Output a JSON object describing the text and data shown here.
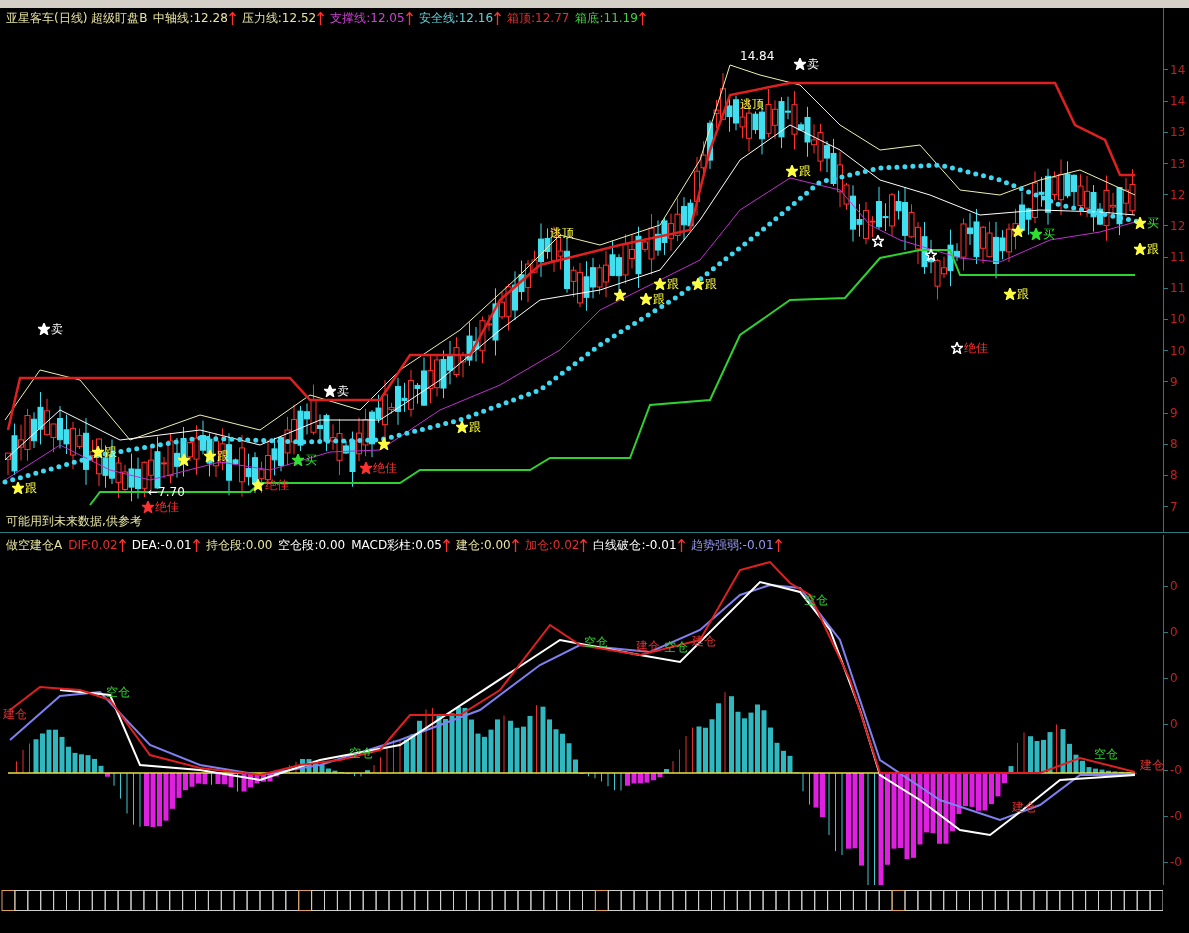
{
  "upper_panel": {
    "legend": [
      {
        "text": "亚星客车(日线) 超级盯盘B",
        "kind": "cream",
        "arrow": false
      },
      {
        "text": "中轴线:12.28",
        "kind": "cream",
        "arrow": true
      },
      {
        "text": "压力线:12.52",
        "kind": "cream",
        "arrow": true
      },
      {
        "text": "支撑线:12.05",
        "kind": "magenta",
        "arrow": true
      },
      {
        "text": "安全线:12.16",
        "kind": "cyan",
        "arrow": true
      },
      {
        "text": "箱顶:12.77",
        "kind": "red",
        "arrow": false
      },
      {
        "text": "箱底:11.19",
        "kind": "green",
        "arrow": true
      }
    ],
    "note": "可能用到未来数据,供参考",
    "markers": [
      {
        "kind": "filled",
        "color": "#ffffff"
      },
      {
        "kind": "filled",
        "color": "#ffff40"
      },
      {
        "kind": "filled",
        "color": "#ffff40"
      },
      {
        "kind": "filled",
        "color": "#ffff40"
      },
      {
        "kind": "filled",
        "color": "#ffff40"
      },
      {
        "kind": "filled",
        "color": "#ff3030"
      },
      {
        "kind": "filled",
        "color": "#ffff40"
      },
      {
        "kind": "filled",
        "color": "#30e030"
      },
      {
        "kind": "filled",
        "color": "#ffffff"
      },
      {
        "kind": "filled",
        "color": "#ff3030"
      },
      {
        "kind": "filled",
        "color": "#ffff40"
      },
      {
        "kind": "filled",
        "color": "#ffff40"
      },
      {
        "kind": "filled",
        "color": "#ffff40"
      },
      {
        "kind": "filled",
        "color": "#ffff40"
      },
      {
        "kind": "filled",
        "color": "#ffff40"
      },
      {
        "kind": "filled",
        "color": "#ffff40"
      },
      {
        "kind": "filled",
        "color": "#ffffff"
      },
      {
        "kind": "filled",
        "color": "#ffff40"
      },
      {
        "kind": "hollow",
        "color": "#ffffff"
      },
      {
        "kind": "hollow",
        "color": "#ffffff"
      },
      {
        "kind": "filled",
        "color": "#ffff40"
      },
      {
        "kind": "filled",
        "color": "#30e030"
      },
      {
        "kind": "filled",
        "color": "#ffff40"
      },
      {
        "kind": "hollow",
        "color": "#ffffff"
      },
      {
        "kind": "filled",
        "color": "#ffff40"
      },
      {
        "kind": "filled",
        "color": "#ffff40"
      }
    ],
    "labels": [
      {
        "kind": "sell",
        "text": "卖"
      },
      {
        "kind": "follow",
        "text": "跟"
      },
      {
        "kind": "follow",
        "text": "跟"
      },
      {
        "kind": "follow",
        "text": "跟"
      },
      {
        "kind": "price",
        "text": "←7.70"
      },
      {
        "kind": "best",
        "text": "绝佳"
      },
      {
        "kind": "best",
        "text": "绝佳"
      },
      {
        "kind": "buy",
        "text": "买"
      },
      {
        "kind": "sell",
        "text": "卖"
      },
      {
        "kind": "best",
        "text": "绝佳"
      },
      {
        "kind": "follow",
        "text": "跟"
      },
      {
        "kind": "top",
        "text": "逃顶"
      },
      {
        "kind": "follow",
        "text": "跟"
      },
      {
        "kind": "follow",
        "text": "跟"
      },
      {
        "kind": "follow",
        "text": "跟"
      },
      {
        "kind": "price",
        "text": "14.84"
      },
      {
        "kind": "top",
        "text": "逃顶"
      },
      {
        "kind": "sell",
        "text": "卖"
      },
      {
        "kind": "follow",
        "text": "跟"
      },
      {
        "kind": "buy",
        "text": "买"
      },
      {
        "kind": "follow",
        "text": "跟"
      },
      {
        "kind": "best",
        "text": "绝佳"
      },
      {
        "kind": "buy",
        "text": "买"
      },
      {
        "kind": "follow",
        "text": "跟"
      }
    ],
    "axis_labels": [
      "14",
      "14",
      "13",
      "13",
      "12",
      "12",
      "11",
      "11",
      "10",
      "10",
      "9",
      "9",
      "8",
      "8",
      "7"
    ]
  },
  "lower_panel": {
    "legend": [
      {
        "text": "做空建仓A",
        "kind": "cream",
        "arrow": false
      },
      {
        "text": "DIF:0.02",
        "kind": "red",
        "arrow": true
      },
      {
        "text": "DEA:-0.01",
        "kind": "white",
        "arrow": true
      },
      {
        "text": "持仓段:0.00",
        "kind": "cream",
        "arrow": false
      },
      {
        "text": "空仓段:0.00",
        "kind": "white",
        "arrow": false
      },
      {
        "text": "MACD彩柱:0.05",
        "kind": "white",
        "arrow": true
      },
      {
        "text": "建仓:0.00",
        "kind": "cream",
        "arrow": true
      },
      {
        "text": "加仓:0.02",
        "kind": "red",
        "arrow": true
      },
      {
        "text": "白线破仓:-0.01",
        "kind": "white",
        "arrow": true
      },
      {
        "text": "趋势强弱:-0.01",
        "kind": "lavender",
        "arrow": true
      }
    ],
    "labels": [
      {
        "text": "建仓",
        "kind": "build"
      },
      {
        "text": "空仓",
        "kind": "empty"
      },
      {
        "text": "空仓",
        "kind": "empty"
      },
      {
        "text": "空仓",
        "kind": "empty"
      },
      {
        "text": "建仓",
        "kind": "build"
      },
      {
        "text": "空仓",
        "kind": "empty"
      },
      {
        "text": "建仓",
        "kind": "build"
      },
      {
        "text": "空仓",
        "kind": "empty"
      },
      {
        "text": "建仓",
        "kind": "build"
      },
      {
        "text": "空仓",
        "kind": "empty"
      },
      {
        "text": "建仓",
        "kind": "build"
      }
    ],
    "axis_labels": [
      "0",
      "0",
      "0",
      "0",
      "-0",
      "-0",
      "-0"
    ]
  }
}
